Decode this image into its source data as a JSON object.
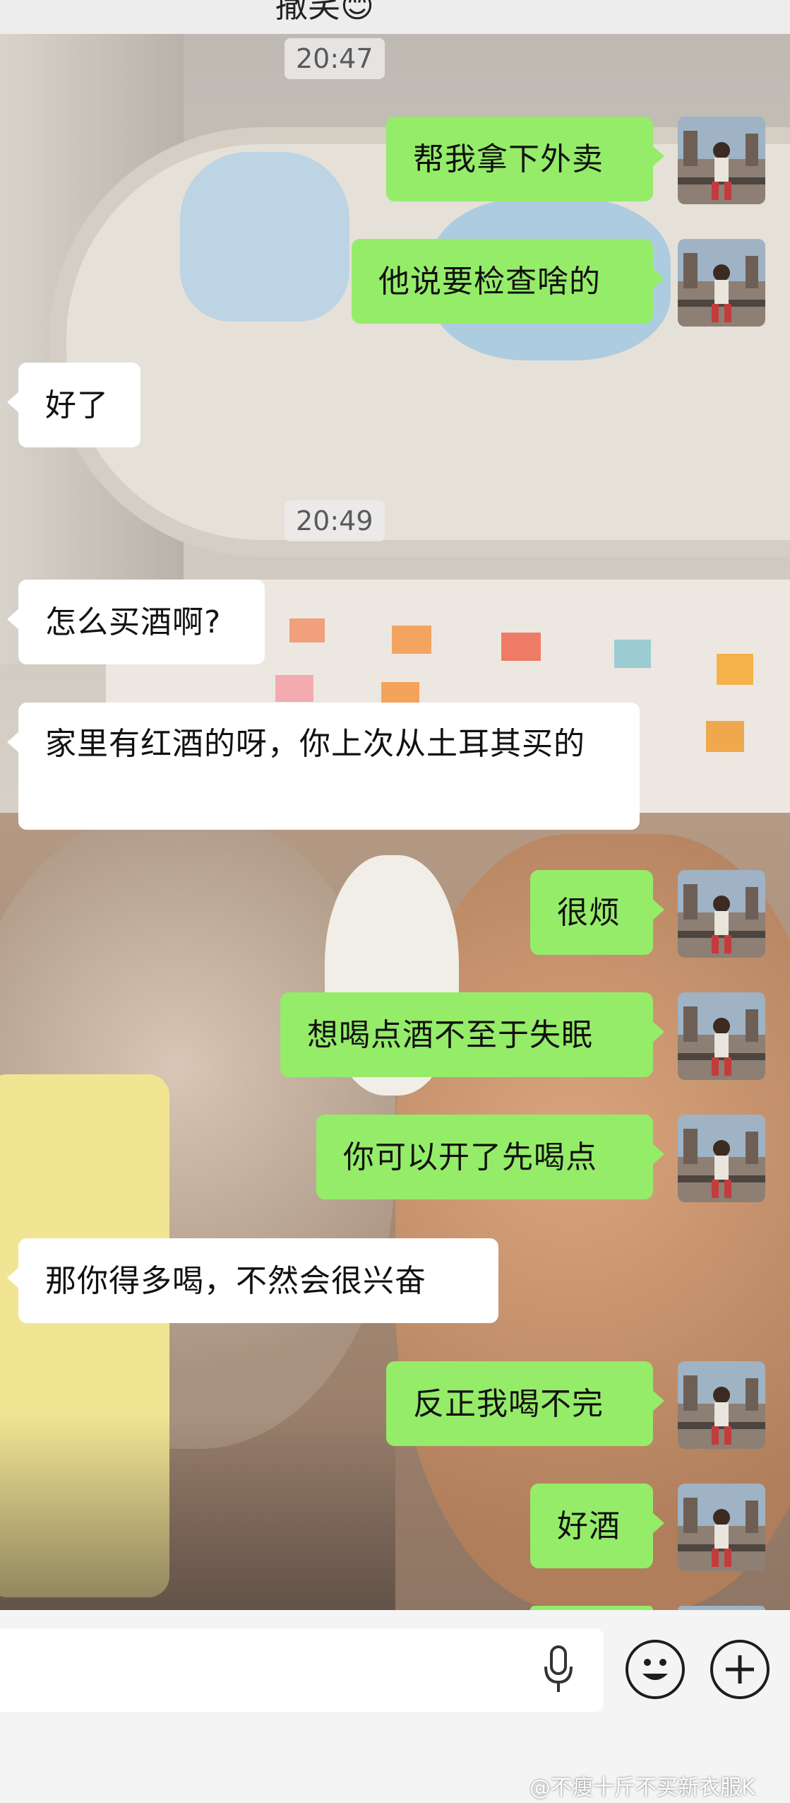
{
  "header": {
    "title": "撒笑😊"
  },
  "messages": [
    {
      "type": "time",
      "text": "20:47"
    },
    {
      "type": "out",
      "text": "帮我拿下外卖"
    },
    {
      "type": "out",
      "text": "他说要检查啥的"
    },
    {
      "type": "in",
      "text": "好了"
    },
    {
      "type": "time",
      "text": "20:49"
    },
    {
      "type": "in",
      "text": "怎么买酒啊?"
    },
    {
      "type": "in",
      "text": "家里有红酒的呀，你上次从土耳其买的"
    },
    {
      "type": "out",
      "text": "很烦"
    },
    {
      "type": "out",
      "text": "想喝点酒不至于失眠"
    },
    {
      "type": "out",
      "text": "你可以开了先喝点"
    },
    {
      "type": "in",
      "text": "那你得多喝，不然会很兴奋"
    },
    {
      "type": "out",
      "text": "反正我喝不完"
    },
    {
      "type": "out",
      "text": "好酒"
    }
  ],
  "input_bar": {
    "icons": [
      "microphone-icon",
      "emoji-icon",
      "plus-icon"
    ]
  },
  "watermark": "@不瘦十斤不买新衣服K",
  "colors": {
    "outgoing_bubble": "#95ec69",
    "incoming_bubble": "#ffffff"
  }
}
